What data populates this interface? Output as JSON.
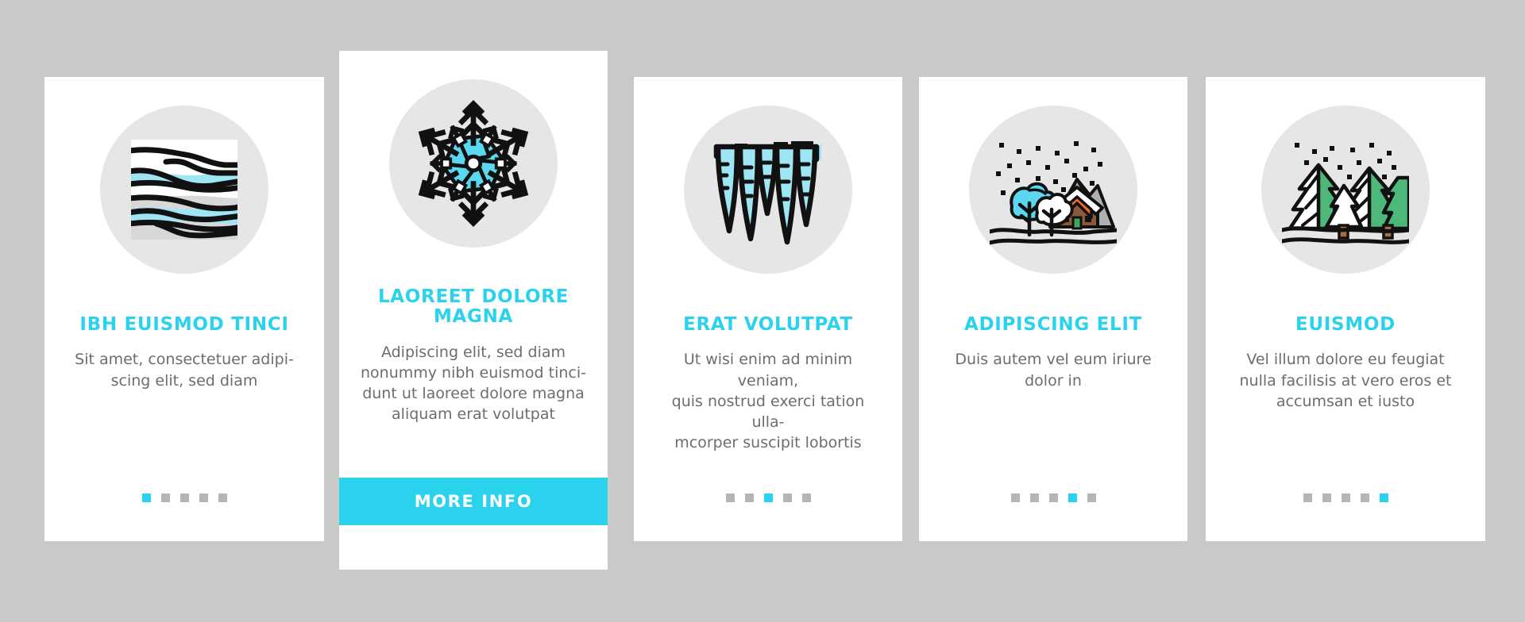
{
  "page": {
    "background_color": "#c9c9c9",
    "accent_color": "#2bd2ee",
    "card_background": "#ffffff",
    "icon_circle_color": "#e6e6e6",
    "dot_inactive_color": "#b5b5b5",
    "body_text_color": "#6d6d6d"
  },
  "cards": [
    {
      "icon_name": "snow-drift-layers-icon",
      "title": "IBH EUISMOD TINCI",
      "body": "Sit amet, consectetuer adipi-\nscing elit, sed diam",
      "dots": {
        "count": 5,
        "active_index": 0
      },
      "button": null
    },
    {
      "icon_name": "snowflake-icon",
      "title": "LAOREET DOLORE MAGNA",
      "body": "Adipiscing elit, sed diam\nnonummy nibh euismod tinci-\ndunt ut laoreet dolore magna\naliquam erat volutpat",
      "dots": null,
      "button": {
        "label": "MORE INFO"
      }
    },
    {
      "icon_name": "icicles-icon",
      "title": "ERAT VOLUTPAT",
      "body": "Ut wisi enim ad minim veniam,\nquis nostrud exerci tation ulla-\nmcorper suscipit lobortis",
      "dots": {
        "count": 5,
        "active_index": 2
      },
      "button": null
    },
    {
      "icon_name": "snowfall-house-mountain-icon",
      "title": "ADIPISCING ELIT",
      "body": "Duis autem vel eum iriure\ndolor in",
      "dots": {
        "count": 5,
        "active_index": 3
      },
      "button": null
    },
    {
      "icon_name": "snowy-pine-forest-icon",
      "title": "EUISMOD",
      "body": "Vel illum dolore eu feugiat\nnulla facilisis at vero eros et\naccumsan et iusto",
      "dots": {
        "count": 5,
        "active_index": 4
      },
      "button": null
    }
  ],
  "icon_colors": {
    "outline": "#111111",
    "ice_blue": "#9fe6f5",
    "cyan": "#5bd8f0",
    "pine_green": "#4cb97a",
    "snow_white": "#ffffff",
    "mountain_gray": "#b0b0b0",
    "roof_orange": "#f2682a",
    "wall_brown": "#8a5a3b",
    "door_green": "#3aa85f",
    "trunk_brown": "#a9703e"
  }
}
